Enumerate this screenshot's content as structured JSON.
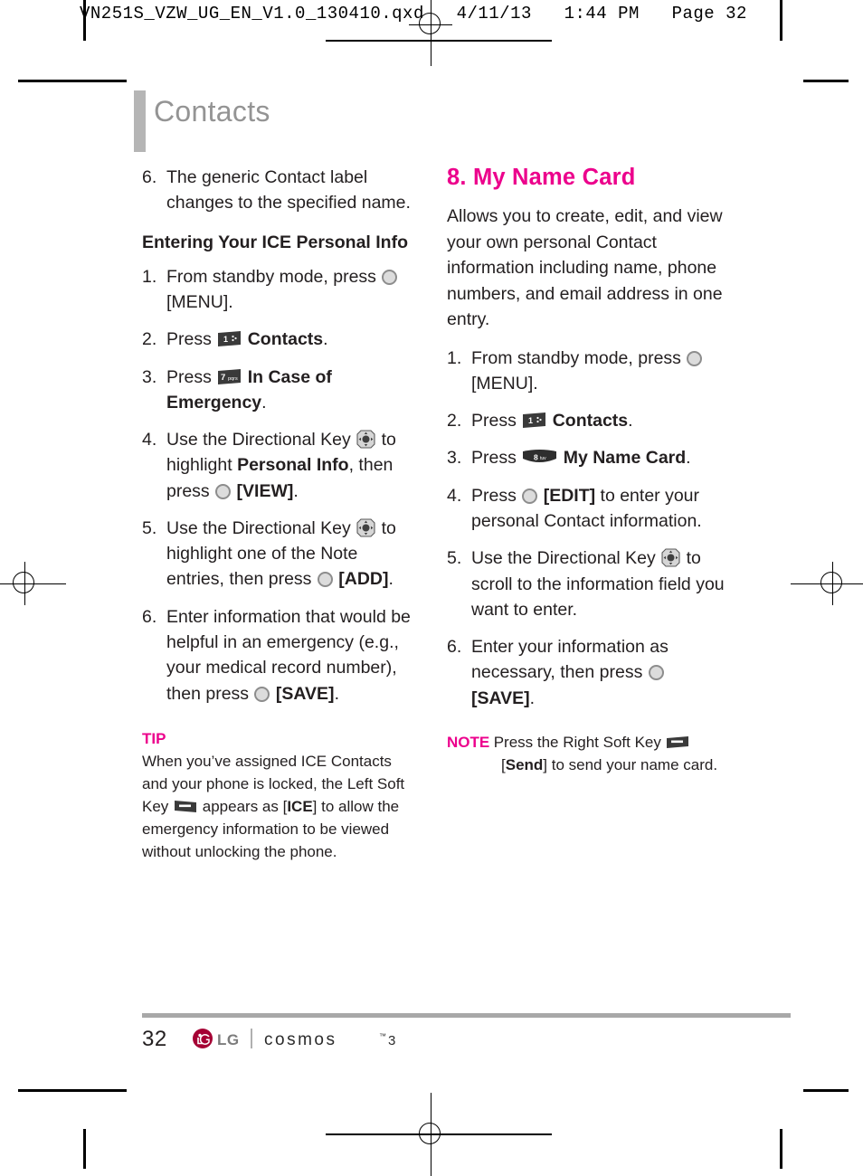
{
  "prepress": {
    "header": "VN251S_VZW_UG_EN_V1.0_130410.qxd   4/11/13   1:44 PM   Page 32"
  },
  "chapter": {
    "title": "Contacts",
    "bar_color": "#b5b5b5",
    "title_color": "#949494"
  },
  "colors": {
    "accent_magenta": "#ec008c",
    "body_text": "#231f20",
    "lg_red": "#a50034"
  },
  "left_column": {
    "step6_top": {
      "num": "6.",
      "text": "The generic Contact label changes to the specified name."
    },
    "subhead": "Entering Your ICE Personal Info",
    "steps": [
      {
        "num": "1.",
        "pre": "From standby mode, press",
        "icon": "ok-key-icon",
        "post": "[MENU]."
      },
      {
        "num": "2.",
        "pre": "Press",
        "icon": "keypad-key-1-icon",
        "post_bold": "Contacts",
        "post": "."
      },
      {
        "num": "3.",
        "pre": "Press",
        "icon": "keypad-key-7-icon",
        "post_bold": "In Case of Emergency",
        "post": "."
      },
      {
        "num": "4.",
        "pre": "Use the Directional Key",
        "icon": "directional-key-icon",
        "mid": "to highlight",
        "bold": "Personal Info",
        "mid2": ", then press",
        "icon2": "ok-key-icon",
        "post_bold2": "[VIEW]",
        "post": "."
      },
      {
        "num": "5.",
        "pre": "Use the Directional Key",
        "icon": "directional-key-icon",
        "mid": "to highlight one of the Note entries, then press",
        "icon2": "ok-key-icon",
        "post_bold2": "[ADD]",
        "post": "."
      },
      {
        "num": "6.",
        "pre": "Enter information that would be helpful in an emergency (e.g., your medical record number), then press",
        "icon2": "ok-key-icon",
        "post_bold2": "[SAVE]",
        "post": "."
      }
    ],
    "tip": {
      "label": "TIP",
      "text_part1": "When you’ve assigned ICE Contacts and your phone is locked, the Left Soft Key",
      "icon": "left-soft-key-icon",
      "text_part2": "appears as [",
      "bold": "ICE",
      "text_part3": "] to allow the emergency information to be viewed without unlocking the phone."
    }
  },
  "right_column": {
    "section_title": "8. My Name Card",
    "intro": "Allows you to create, edit, and view your own personal Contact information including name, phone numbers, and email address in one entry.",
    "steps": [
      {
        "num": "1.",
        "pre": "From standby mode, press",
        "icon": "ok-key-icon",
        "post": "[MENU]."
      },
      {
        "num": "2.",
        "pre": "Press",
        "icon": "keypad-key-1-icon",
        "post_bold": "Contacts",
        "post": "."
      },
      {
        "num": "3.",
        "pre": "Press",
        "icon": "keypad-key-8-icon",
        "post_bold": "My Name Card",
        "post": "."
      },
      {
        "num": "4.",
        "pre": "Press",
        "icon": "ok-key-icon",
        "post_bold": "[EDIT]",
        "post": " to enter your personal Contact information."
      },
      {
        "num": "5.",
        "pre": "Use the Directional Key",
        "icon": "directional-key-icon",
        "mid": "to scroll to the information field you want to enter."
      },
      {
        "num": "6.",
        "pre": "Enter your information as necessary, then press",
        "icon2": "ok-key-icon",
        "post_bold2": "[SAVE]",
        "post": "."
      }
    ],
    "note": {
      "label": "NOTE",
      "text_part1": "Press the Right Soft Key",
      "icon": "right-soft-key-icon",
      "text_part2_bracket_open": "[",
      "bold": "Send",
      "text_part3": "] to send your name card."
    }
  },
  "footer": {
    "page_number": "32",
    "brand": "LG",
    "product": "cosmos",
    "product_tm": "™",
    "product_version": "3"
  }
}
